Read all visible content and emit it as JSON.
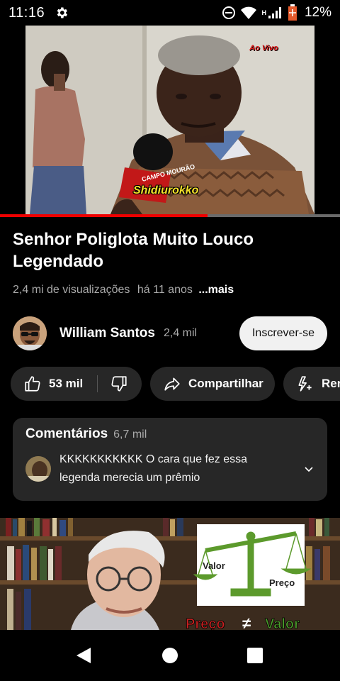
{
  "status_bar": {
    "time": "11:16",
    "network": "H",
    "battery_percent": "12%",
    "battery_level": 0.12
  },
  "player": {
    "overlay_tag": "Ao Vivo",
    "mic_flag_text": "CAMPO MOURÃO",
    "subtitle": "Shidiurokko",
    "progress": 0.61
  },
  "video": {
    "title": "Senhor Poliglota Muito Louco Legendado",
    "views": "2,4 mi de visualizações",
    "age": "há 11 anos",
    "more_label": "...mais"
  },
  "channel": {
    "name": "William Santos",
    "subscribers": "2,4 mil",
    "subscribe_label": "Inscrever-se"
  },
  "actions": {
    "like_count": "53 mil",
    "share_label": "Compartilhar",
    "remix_label": "Remix"
  },
  "comments": {
    "title": "Comentários",
    "count": "6,7 mil",
    "top_comment": "KKKKKKKKKKK O cara que fez essa legenda merecia um prêmio"
  },
  "next_video": {
    "scale_left": "Valor",
    "scale_right": "Preço",
    "caption_left": "Preço",
    "caption_symbol": "≠",
    "caption_right": "Valor"
  },
  "colors": {
    "background": "#000000",
    "chip": "#272727",
    "progress_red": "#ff0000",
    "subscribe_bg": "#f1f1f1",
    "muted_text": "#aaaaaa"
  }
}
